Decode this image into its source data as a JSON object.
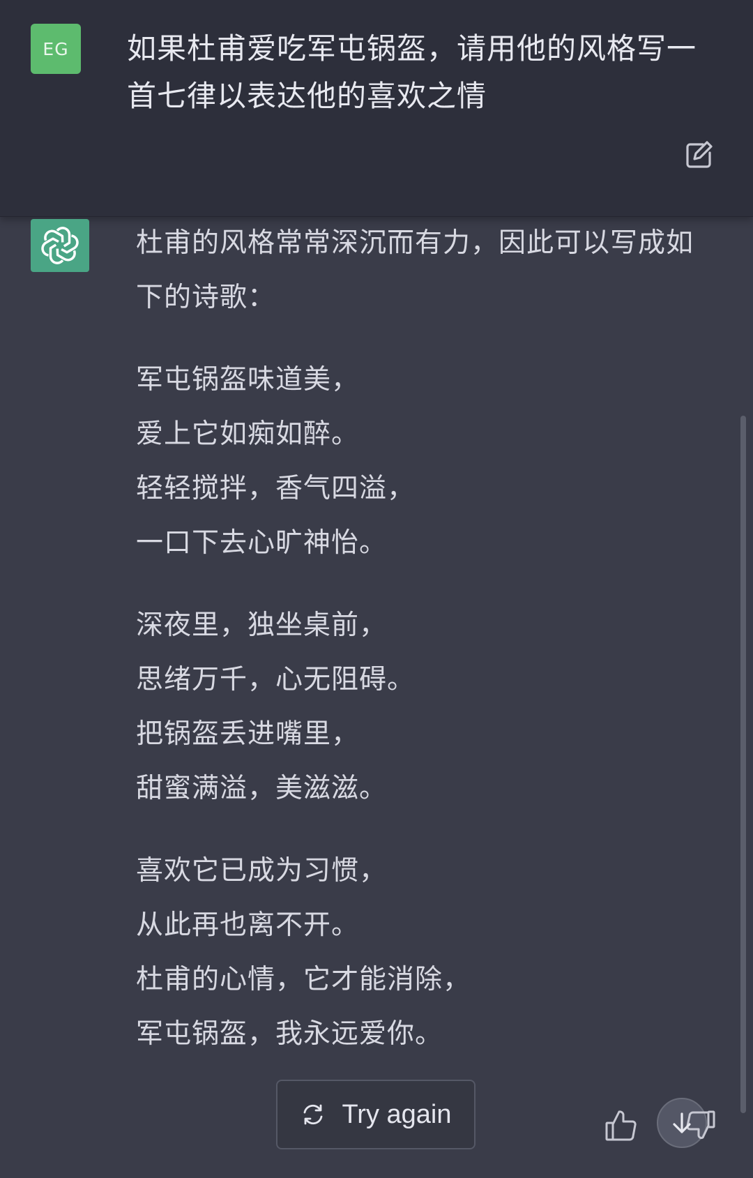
{
  "user_message": {
    "avatar_initials": "EG",
    "text": "如果杜甫爱吃军屯锅盔，请用他的风格写一首七律以表达他的喜欢之情"
  },
  "assistant_message": {
    "intro": "杜甫的风格常常深沉而有力，因此可以写成如下的诗歌：",
    "stanzas": [
      [
        "军屯锅盔味道美，",
        "爱上它如痴如醉。",
        "轻轻搅拌，香气四溢，",
        "一口下去心旷神怡。"
      ],
      [
        "深夜里，独坐桌前，",
        "思绪万千，心无阻碍。",
        "把锅盔丢进嘴里，",
        "甜蜜满溢，美滋滋。"
      ],
      [
        "喜欢它已成为习惯，",
        "从此再也离不开。",
        "杜甫的心情，它才能消除，",
        "军屯锅盔，我永远爱你。"
      ]
    ]
  },
  "controls": {
    "try_again_label": "Try again"
  },
  "icons": {
    "edit": "edit-icon",
    "assistant_avatar": "openai-logo-icon",
    "regenerate": "refresh-icon",
    "thumbs_up": "thumbs-up-icon",
    "thumbs_down": "thumbs-down-icon",
    "scroll_down": "arrow-down-icon"
  },
  "colors": {
    "user_background": "#2d2f3b",
    "assistant_background": "#3a3c49",
    "user_avatar": "#5dbb6e",
    "assistant_avatar": "#4aa585"
  }
}
